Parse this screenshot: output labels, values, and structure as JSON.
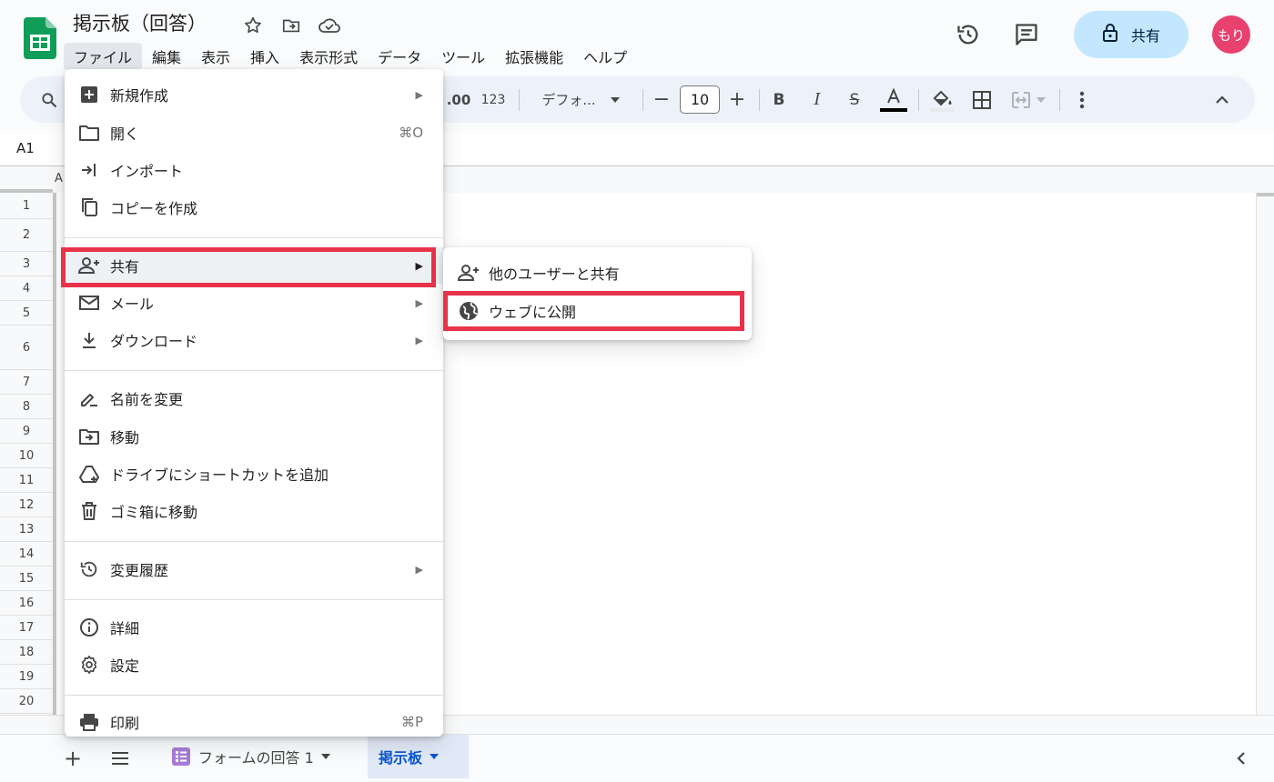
{
  "header": {
    "doc_title": "掲示板（回答）",
    "share_label": "共有",
    "avatar_text": "もり"
  },
  "menubar": [
    "ファイル",
    "編集",
    "表示",
    "挿入",
    "表示形式",
    "データ",
    "ツール",
    "拡張機能",
    "ヘルプ"
  ],
  "toolbar": {
    "decimal_label": ".00",
    "format_123": "123",
    "font_name": "デフォ...",
    "font_size": "10"
  },
  "formula_bar": {
    "cell_ref": "A1"
  },
  "grid": {
    "col_a": "A",
    "rows": [
      "1",
      "2",
      "3",
      "4",
      "5",
      "6",
      "7",
      "8",
      "9",
      "10",
      "11",
      "12",
      "13",
      "14",
      "15",
      "16",
      "17",
      "18",
      "19",
      "20"
    ]
  },
  "file_menu": {
    "items": [
      {
        "label": "新規作成",
        "icon": "add-box-icon"
      },
      {
        "label": "開く",
        "shortcut": "⌘O",
        "icon": "folder-icon"
      },
      {
        "label": "インポート",
        "icon": "import-icon"
      },
      {
        "label": "コピーを作成",
        "icon": "copy-icon"
      },
      {
        "label": "共有",
        "icon": "person-add-icon"
      },
      {
        "label": "メール",
        "icon": "mail-icon"
      },
      {
        "label": "ダウンロード",
        "icon": "download-icon"
      },
      {
        "label": "名前を変更",
        "icon": "rename-icon"
      },
      {
        "label": "移動",
        "icon": "folder-move-icon"
      },
      {
        "label": "ドライブにショートカットを追加",
        "icon": "drive-shortcut-icon"
      },
      {
        "label": "ゴミ箱に移動",
        "icon": "trash-icon"
      },
      {
        "label": "変更履歴",
        "icon": "history-icon"
      },
      {
        "label": "詳細",
        "icon": "info-icon"
      },
      {
        "label": "設定",
        "icon": "gear-icon"
      },
      {
        "label": "印刷",
        "shortcut": "⌘P",
        "icon": "print-icon"
      }
    ]
  },
  "share_submenu": {
    "items": [
      {
        "label": "他のユーザーと共有",
        "icon": "person-add-icon"
      },
      {
        "label": "ウェブに公開",
        "icon": "globe-icon"
      }
    ]
  },
  "sheets": {
    "tabs": [
      {
        "label": "フォームの回答 1"
      },
      {
        "label": "掲示板"
      }
    ]
  },
  "colors": {
    "highlight_box": "#e8334a",
    "share_button": "#c2e7ff",
    "avatar": "#e8416e",
    "active_tab_text": "#0b57d0"
  }
}
